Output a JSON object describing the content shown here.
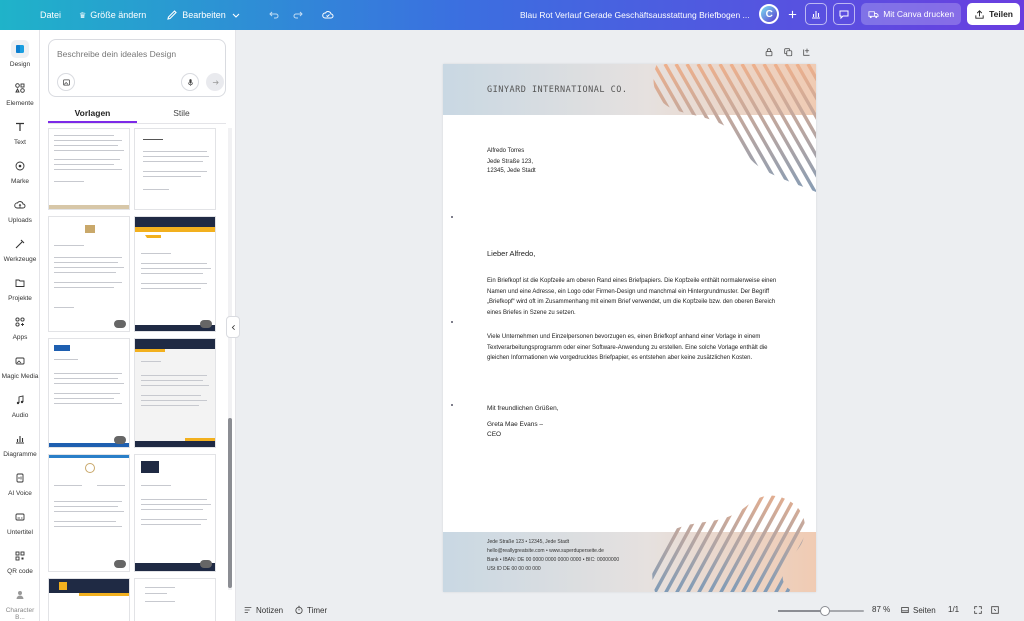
{
  "topbar": {
    "file_label": "Datei",
    "resize_label": "Größe ändern",
    "edit_label": "Bearbeiten",
    "doc_title": "Blau Rot Verlauf Gerade Geschäftsausstattung Briefbogen ...",
    "avatar_letter": "C",
    "print_label": "Mit Canva drucken",
    "share_label": "Teilen"
  },
  "rail": {
    "items": [
      {
        "label": "Design",
        "icon": "design-icon"
      },
      {
        "label": "Elemente",
        "icon": "elements-icon"
      },
      {
        "label": "Text",
        "icon": "text-icon"
      },
      {
        "label": "Marke",
        "icon": "brand-icon"
      },
      {
        "label": "Uploads",
        "icon": "upload-icon"
      },
      {
        "label": "Werkzeuge",
        "icon": "tools-icon"
      },
      {
        "label": "Projekte",
        "icon": "folder-icon"
      },
      {
        "label": "Apps",
        "icon": "apps-icon"
      },
      {
        "label": "Magic Media",
        "icon": "magic-media-icon"
      },
      {
        "label": "Audio",
        "icon": "audio-icon"
      },
      {
        "label": "Diagramme",
        "icon": "chart-icon"
      },
      {
        "label": "AI Voice",
        "icon": "ai-voice-icon"
      },
      {
        "label": "Untertitel",
        "icon": "subtitles-icon"
      },
      {
        "label": "QR code",
        "icon": "qr-icon"
      },
      {
        "label": "Character B...",
        "icon": "character-icon"
      }
    ]
  },
  "panel": {
    "search_placeholder": "Beschreibe dein ideales Design",
    "tabs": [
      {
        "label": "Vorlagen"
      },
      {
        "label": "Stile"
      }
    ]
  },
  "letter": {
    "company": "GINYARD INTERNATIONAL CO.",
    "recipient_name": "Alfredo Torres",
    "recipient_street": "Jede Straße 123,",
    "recipient_city": "12345, Jede Stadt",
    "salutation": "Lieber Alfredo,",
    "paragraph1": "Ein Briefkopf ist die Kopfzeile am oberen Rand eines Briefpapiers. Die Kopfzeile enthält normalerweise einen Namen und eine Adresse, ein Logo oder Firmen-Design und manchmal ein Hintergrundmuster. Der Begriff „Briefkopf“ wird oft im Zusammenhang mit einem Brief verwendet, um die Kopfzeile bzw. den oberen Bereich eines Briefes in Szene zu setzen.",
    "paragraph2": "Viele Unternehmen und Einzelpersonen bevorzugen es, einen Briefkopf anhand einer Vorlage in einem Textverarbeitungsprogramm oder einer Software-Anwendung zu erstellen. Eine solche Vorlage enthält die gleichen Informationen wie vorgedrucktes Briefpapier, es entstehen aber keine zusätzlichen Kosten.",
    "closing": "Mit freundlichen Grüßen,",
    "signer_name": "Greta Mae Evans –",
    "signer_title": "CEO",
    "footer_line1": "Jede Straße 123 • 12345, Jede Stadt",
    "footer_line2": "hello@reallygreatsite.com • www.superduperseite.de",
    "footer_line3": "Bank • IBAN: DE 00 0000 0000 0000 0000 • BIC: 00000000",
    "footer_line4": "USt ID DE 00 00 00 000"
  },
  "bottombar": {
    "notes_label": "Notizen",
    "timer_label": "Timer",
    "zoom_label": "87 %",
    "zoom_value": 0.55,
    "pages_label": "Seiten",
    "page_count": "1/1"
  },
  "colors": {
    "accent": "#7d2ae8",
    "stripe_orange": "#eeb08c",
    "stripe_blue": "#7e9bb8"
  }
}
